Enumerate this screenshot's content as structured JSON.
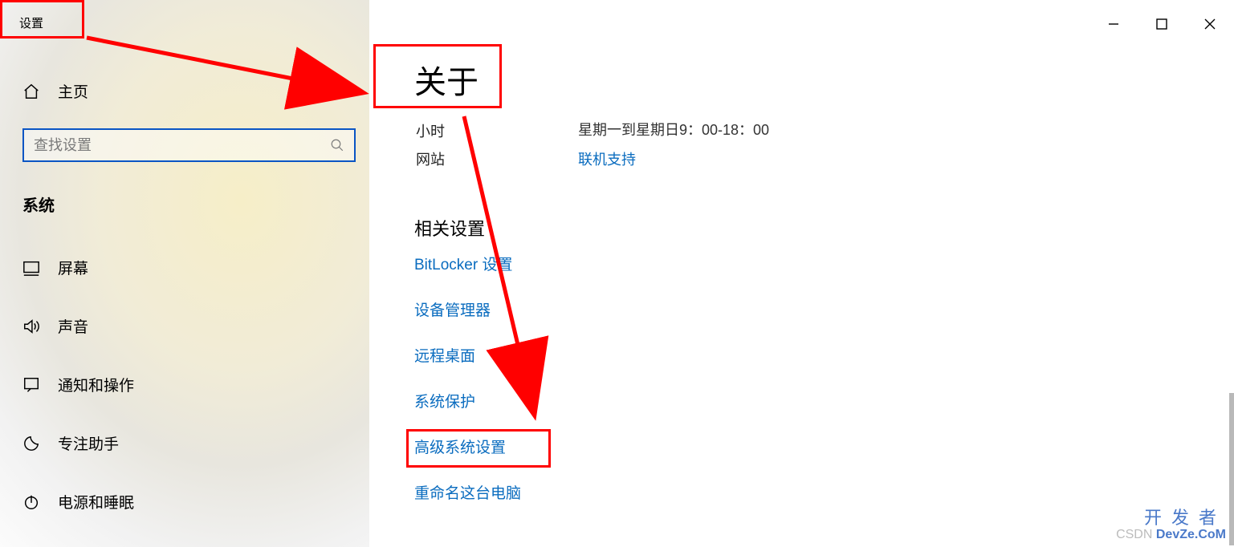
{
  "app_title": "设置",
  "home_label": "主页",
  "search_placeholder": "查找设置",
  "sidebar_section": "系统",
  "nav": [
    {
      "id": "display",
      "label": "屏幕"
    },
    {
      "id": "sound",
      "label": "声音"
    },
    {
      "id": "notifications",
      "label": "通知和操作"
    },
    {
      "id": "focus",
      "label": "专注助手"
    },
    {
      "id": "power",
      "label": "电源和睡眠"
    }
  ],
  "page_title": "关于",
  "hours_label": "小时",
  "hours_value": "星期一到星期日9：00-18：00",
  "site_label": "网站",
  "site_link": "联机支持",
  "related_title": "相关设置",
  "related_links": [
    "BitLocker 设置",
    "设备管理器",
    "远程桌面",
    "系统保护",
    "高级系统设置",
    "重命名这台电脑"
  ],
  "watermark_cn": "开发者",
  "watermark_en_pre": "CSDN",
  "watermark_en_bold": "DevZe.CoM",
  "colors": {
    "red": "#ff0000",
    "link": "#0a6cbf",
    "border_blue": "#0a55c4"
  }
}
